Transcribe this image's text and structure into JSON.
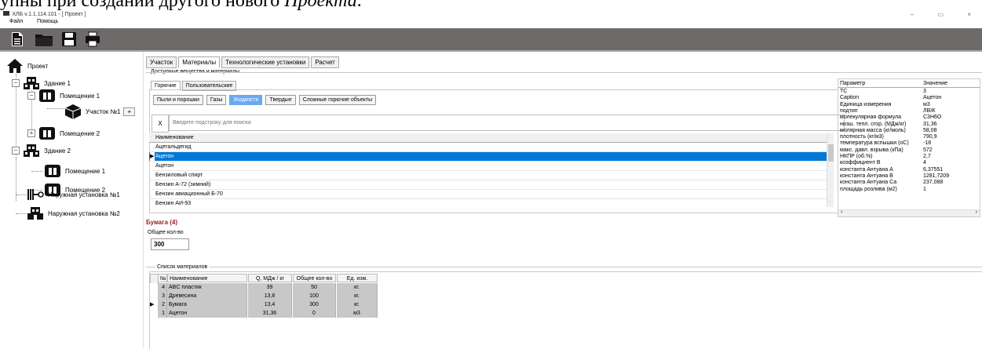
{
  "doc_caption": {
    "text": "упны при создании другого нового ",
    "italic": "Проекта",
    "end": "."
  },
  "window": {
    "title": "КЛБ v.1.1.114.101 - [ Проект ]",
    "controls": "–  ▭  ×"
  },
  "menu": [
    "Файл",
    "Помощь"
  ],
  "toolbar_icons": [
    "new-document-icon",
    "open-folder-icon",
    "save-disk-icon",
    "print-icon"
  ],
  "tree": {
    "root": "Проект",
    "building1": "Здание 1",
    "room1_1": "Помещение 1",
    "section1": "Участок №1",
    "section1_add": "+",
    "room1_2": "Помещение 2",
    "building2": "Здание 2",
    "room2_1": "Помещение 1",
    "room2_2": "Помещение 2",
    "outdoor1": "Наружная установка №1",
    "outdoor2": "Наружная установка №2"
  },
  "tabs": [
    "Участок",
    "Материалы",
    "Технологические установки",
    "Расчет"
  ],
  "active_tab": 1,
  "available_group": "Доступные вещества и материалы",
  "subtabs": [
    "Горючие",
    "Пользовательские"
  ],
  "category_buttons": [
    "Пыли и порошки",
    "Газы",
    "Жидкости",
    "Твердые",
    "Сложные горючие объекты"
  ],
  "active_category": 2,
  "search": {
    "clear_label": "X",
    "placeholder": "Введите подстроку для поиска"
  },
  "substances": {
    "header": "Наименование",
    "rows": [
      "Ацетальдегид",
      "Ацетон",
      "Ацетон",
      "Бензиловый спирт",
      "Бензин А-72 (зимний)",
      "Бензин авиационный Б-70",
      "Бензин АИ-93"
    ],
    "selected_index": 1
  },
  "params": {
    "header": [
      "Параметр",
      "Значение"
    ],
    "rows": [
      [
        "ТС",
        "3"
      ],
      [
        "Caption",
        "Ацетон"
      ],
      [
        "Единица измерения",
        "м3"
      ],
      [
        "подтип",
        "ЛВЖ"
      ],
      [
        "молекулярная формула",
        "C3H6O"
      ],
      [
        "низш. тепл. сгор. (МДж/кг)",
        "31,36"
      ],
      [
        "молярная масса (кг/моль)",
        "58,08"
      ],
      [
        "плотность (кг/м3)",
        "790,9"
      ],
      [
        "температура вспышки (оС)",
        "-18"
      ],
      [
        "макс. давл. взрыва (кПа)",
        "572"
      ],
      [
        "НКПР (об.%)",
        "2,7"
      ],
      [
        "коэффициент В",
        "4"
      ],
      [
        "константа Антуана А",
        "6,37551"
      ],
      [
        "константа Антуана В",
        "1281,7209"
      ],
      [
        "константа Антуана Са",
        "237,088"
      ],
      [
        "площадь розлива (м2)",
        "1"
      ]
    ]
  },
  "selected_material": {
    "title": "Бумага (4)",
    "qty_label": "Общее кол-во",
    "qty_value": "300"
  },
  "materials_list": {
    "group": "Список материалов",
    "header": [
      "№",
      "Наименование",
      "Q, МДж / кг",
      "Общее кол-во",
      "Ед. изм."
    ],
    "rows": [
      [
        "4",
        "ABC пластик",
        "39",
        "50",
        "кг."
      ],
      [
        "3",
        "Древесина",
        "13,8",
        "100",
        "кг."
      ],
      [
        "2",
        "Бумага",
        "13,4",
        "300",
        "кг."
      ],
      [
        "1",
        "Ацетон",
        "31,36",
        "0",
        "м3"
      ]
    ],
    "current_index": 2
  },
  "colors": {
    "toolbar": "#6e6a69",
    "selection": "#0078d7",
    "active_button": "#6aa8ef",
    "material_title": "#a0202a",
    "grid_cells": "#c8c8c8"
  }
}
